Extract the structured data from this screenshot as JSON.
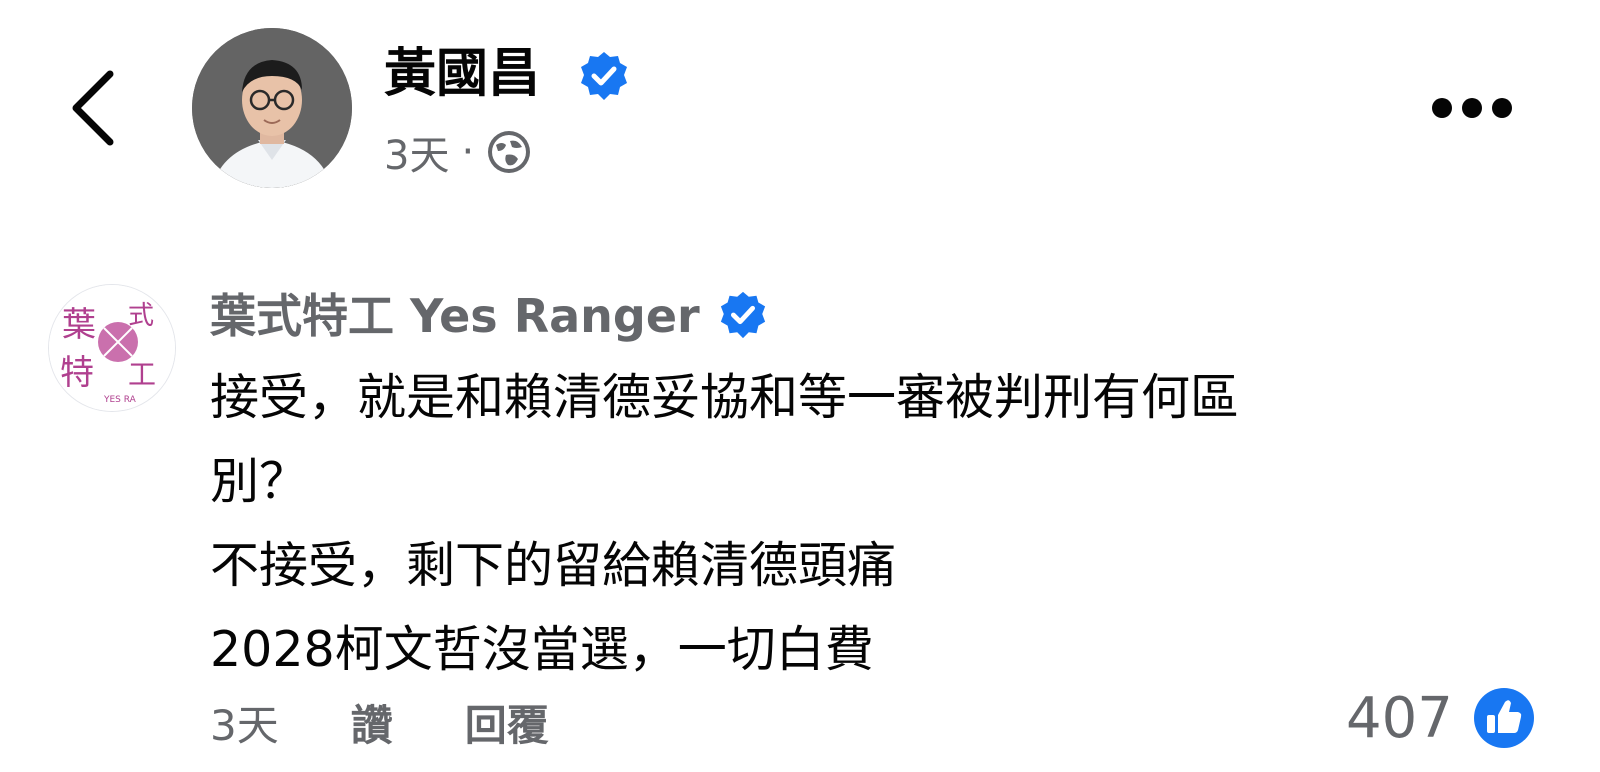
{
  "post": {
    "author_name": "黃國昌",
    "time": "3天",
    "separator": "·",
    "privacy_icon": "globe-icon",
    "verified_icon": "verified-badge-icon"
  },
  "comment": {
    "author_name": "葉式特工 Yes Ranger",
    "avatar_text": [
      "葉",
      "式",
      "特",
      "工",
      "YES RA"
    ],
    "verified_icon": "verified-badge-icon",
    "lines": [
      "接受，就是和賴清德妥協和等一審被判刑有何區",
      "別？",
      "不接受，剩下的留給賴清德頭痛",
      "2028柯文哲沒當選，一切白費"
    ],
    "time": "3天",
    "like_label": "讚",
    "reply_label": "回覆",
    "reaction_count": "407",
    "reaction_icon": "like-thumb-icon"
  },
  "colors": {
    "text_primary": "#050505",
    "text_secondary": "#65676b",
    "brand_blue": "#1877f2",
    "avatar_magenta": "#b0408f"
  }
}
